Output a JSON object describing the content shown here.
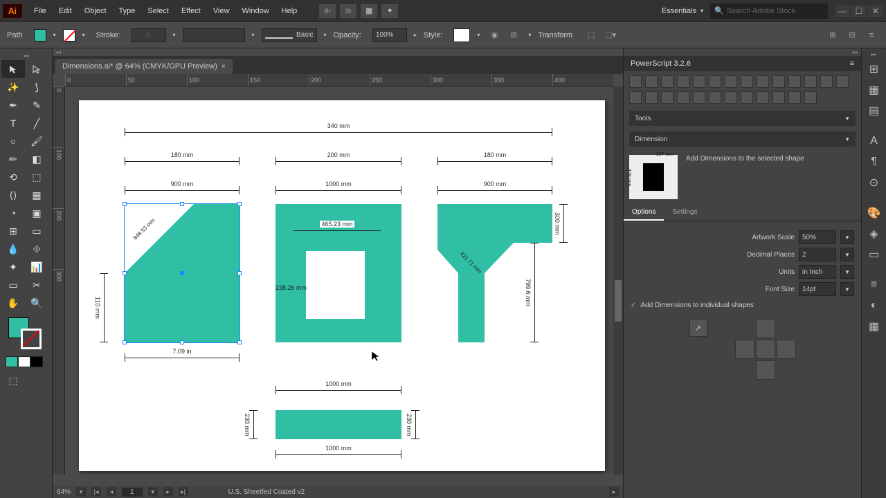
{
  "menu": {
    "items": [
      "File",
      "Edit",
      "Object",
      "Type",
      "Select",
      "Effect",
      "View",
      "Window",
      "Help"
    ]
  },
  "workspace": "Essentials",
  "search_placeholder": "Search Adobe Stock",
  "control": {
    "mode": "Path",
    "stroke_label": "Stroke:",
    "brush_label": "Basic",
    "opacity_label": "Opacity:",
    "opacity_value": "100%",
    "style_label": "Style:",
    "transform_label": "Transform"
  },
  "tab": {
    "title": "Dimensions.ai* @ 64% (CMYK/GPU Preview)"
  },
  "ruler_h": [
    "0",
    "50",
    "100",
    "150",
    "200",
    "250",
    "300",
    "350",
    "400"
  ],
  "ruler_v": [
    "0",
    "100",
    "200",
    "300"
  ],
  "dimensions": {
    "top_overall": "340 mm",
    "col1_top": "180 mm",
    "col2_top": "200 mm",
    "col3_top": "180 mm",
    "col1_mid": "900 mm",
    "col2_mid": "1000 mm",
    "col3_mid": "900 mm",
    "shape1_diag": "848.53 mm",
    "shape1_left": "110 mm",
    "shape1_bottom": "7.09 in",
    "shape2_inner_w": "465.23 mm",
    "shape2_inner_h": "238.26 mm",
    "shape3_right_top": "300 mm",
    "shape3_right_full": "799.6 mm",
    "shape3_diag": "421.71 mm",
    "shape4_top": "1000 mm",
    "shape4_bottom": "1000 mm",
    "shape4_left": "230 mm",
    "shape4_right": "230 mm"
  },
  "status": {
    "zoom": "64%",
    "page": "1",
    "profile": "U.S. Sheetfed Coated v2"
  },
  "panel": {
    "title": "PowerScript 3.2.6",
    "tools_label": "Tools",
    "dimension_label": "Dimension",
    "hint": "Add Dimensions to the selected shape",
    "preview_w": "397 mm",
    "preview_h": "478 mm",
    "tabs": {
      "options": "Options",
      "settings": "Settings"
    },
    "artwork_scale_label": "Artwork Scale",
    "artwork_scale": "50%",
    "decimal_label": "Decimal Places",
    "decimal": "2",
    "units_label": "Units",
    "units": "in Inch",
    "fontsize_label": "Font Size",
    "fontsize": "14pt",
    "individual": "Add Dimensions to individual shapes"
  }
}
